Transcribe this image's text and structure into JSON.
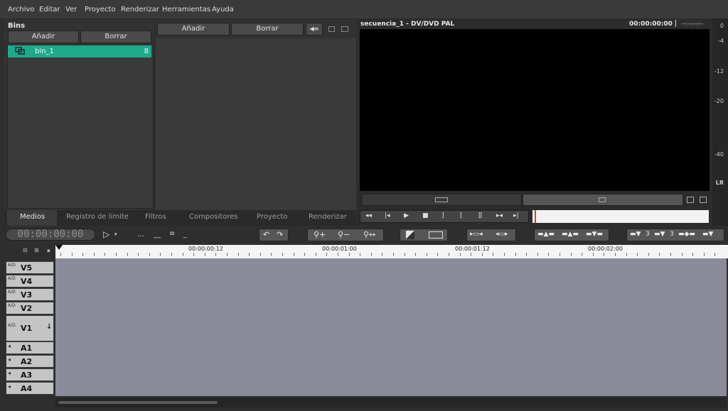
{
  "menu": [
    "Archivo",
    "Editar",
    "Ver",
    "Proyecto",
    "Renderizar",
    "Herramientas",
    "Ayuda"
  ],
  "bins": {
    "title": "Bins",
    "add_label": "Añadir",
    "delete_label": "Borrar",
    "items": [
      {
        "name": "bin_1",
        "count": "8"
      }
    ]
  },
  "media": {
    "add_label": "Añadir",
    "delete_label": "Borrar"
  },
  "tabs": [
    "Medios",
    "Registro de límite",
    "Filtros",
    "Compositores",
    "Proyecto",
    "Renderizar"
  ],
  "viewer": {
    "sequence_title": "secuencia_1  -  DV/DVD PAL",
    "timecode": "00:00:00:00",
    "aux_timecode": "--:--:--:--"
  },
  "meter": {
    "labels": [
      "0",
      "-4",
      "-12",
      "-20",
      "-40",
      "LR"
    ]
  },
  "timeline": {
    "timecode": "00:00:00:00",
    "ruler": [
      "00:00:00:12",
      "00:00:01:00",
      "00:00:01:12",
      "00:00:02:00"
    ],
    "tracks": [
      {
        "name": "V5",
        "icon": "A/D"
      },
      {
        "name": "V4",
        "icon": "A/D"
      },
      {
        "name": "V3",
        "icon": "A/D"
      },
      {
        "name": "V2",
        "icon": "A/D"
      },
      {
        "name": "V1",
        "icon": "A/D"
      },
      {
        "name": "A1",
        "icon": "◂"
      },
      {
        "name": "A2",
        "icon": "◂"
      },
      {
        "name": "A3",
        "icon": "◂"
      },
      {
        "name": "A4",
        "icon": "◂"
      }
    ],
    "toolbar": {
      "btn_3a": "3",
      "btn_3b": "3"
    }
  },
  "colors": {
    "accent": "#1fa98b",
    "timeline_bg": "#8a8c9a",
    "playhead": "#d04040"
  }
}
